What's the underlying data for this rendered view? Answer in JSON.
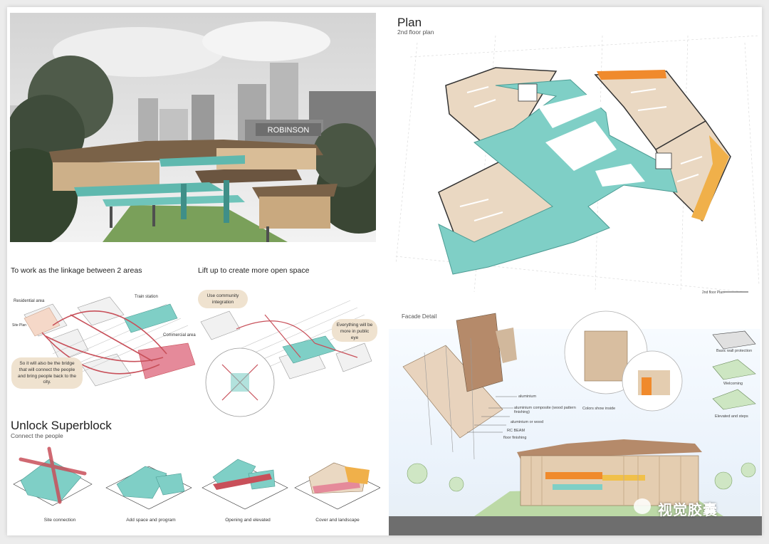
{
  "plan": {
    "title": "Plan",
    "subtitle": "2nd floor plan",
    "legend_title": "2nd floor Plan"
  },
  "diagram1": {
    "title": "To work as the linkage between 2 areas",
    "labels": {
      "residential": "Residential area",
      "train": "Train station",
      "commercial": "Commercial area",
      "site_plan": "Site Plan"
    },
    "bubble": "So it will also be the bridge that will connect the people and bring people back to the city."
  },
  "diagram2": {
    "title": "Lift up to create more open space",
    "bubble_top": "Use community integration",
    "bubble_right": "Everything will be more in public eye"
  },
  "superblock": {
    "title": "Unlock Superblock",
    "subtitle": "Connect the people",
    "steps": [
      {
        "label": "Site connection"
      },
      {
        "label": "Add space and program"
      },
      {
        "label": "Opening and elevated"
      },
      {
        "label": "Cover and landscape"
      }
    ]
  },
  "facade": {
    "title": "Facade Detail",
    "materials": [
      "aluminium",
      "aluminium composite (wood pattern finishing)",
      "aluminium or wood",
      "RC BEAM",
      "floor finishing"
    ],
    "colors_note": "Colors show inside",
    "roof": [
      "Basic wall protection",
      "Welcoming",
      "Elevated and steps"
    ]
  },
  "photo": {
    "sign": "ROBINSON"
  },
  "watermark": "视觉胶囊",
  "colors": {
    "teal": "#7fcfc6",
    "beige": "#ead8c2",
    "red": "#c8505a",
    "pink": "#e58a9a",
    "orange": "#f08a2c"
  }
}
